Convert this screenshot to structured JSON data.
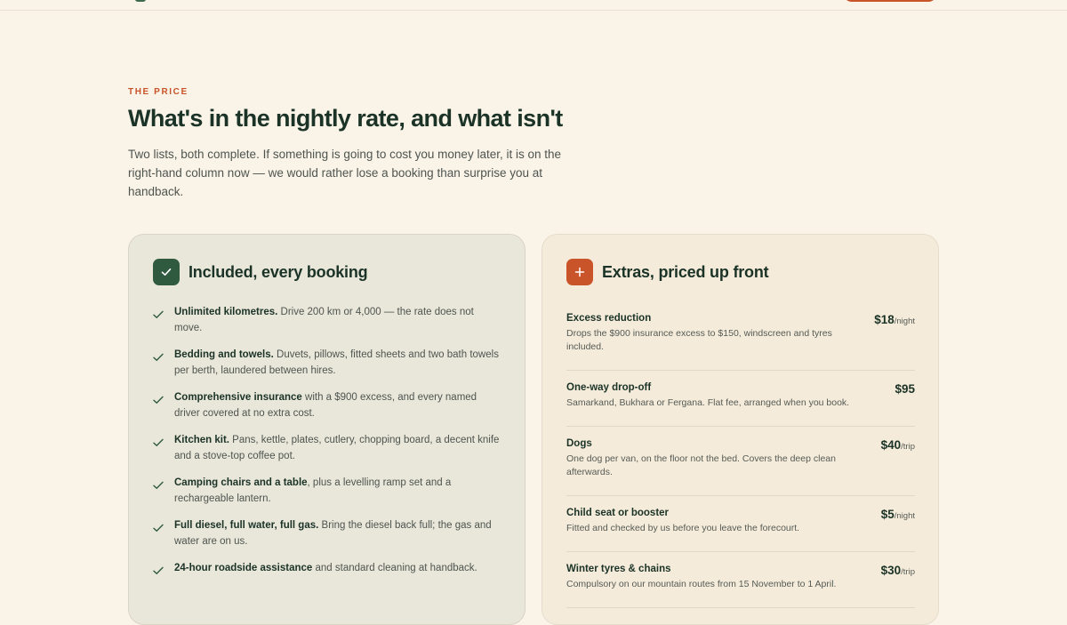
{
  "colors": {
    "background": "#faf3e8",
    "accent": "#c9542a",
    "green": "#2f5a40",
    "heading": "#1b3327"
  },
  "section": {
    "eyebrow": "THE PRICE",
    "headline": "What's in the nightly rate, and what isn't",
    "intro": "Two lists, both complete. If something is going to cost you money later, it is on the right-hand column now — we would rather lose a booking than surprise you at handback."
  },
  "included": {
    "icon": "check-icon",
    "title": "Included, every booking",
    "items": [
      {
        "bold": "Unlimited kilometres.",
        "text": " Drive 200 km or 4,000 — the rate does not move."
      },
      {
        "bold": "Bedding and towels.",
        "text": " Duvets, pillows, fitted sheets and two bath towels per berth, laundered between hires."
      },
      {
        "bold": "Comprehensive insurance",
        "text": " with a $900 excess, and every named driver covered at no extra cost."
      },
      {
        "bold": "Kitchen kit.",
        "text": " Pans, kettle, plates, cutlery, chopping board, a decent knife and a stove-top coffee pot."
      },
      {
        "bold": "Camping chairs and a table",
        "text": ", plus a levelling ramp set and a rechargeable lantern."
      },
      {
        "bold": "Full diesel, full water, full gas.",
        "text": " Bring the diesel back full; the gas and water are on us."
      },
      {
        "bold": "24-hour roadside assistance",
        "text": " and standard cleaning at handback."
      }
    ]
  },
  "extras": {
    "icon": "plus-icon",
    "title": "Extras, priced up front",
    "items": [
      {
        "name": "Excess reduction",
        "desc": "Drops the $900 insurance excess to $150, windscreen and tyres included.",
        "price": "$18",
        "unit": "/night"
      },
      {
        "name": "One-way drop-off",
        "desc": "Samarkand, Bukhara or Fergana. Flat fee, arranged when you book.",
        "price": "$95",
        "unit": ""
      },
      {
        "name": "Dogs",
        "desc": "One dog per van, on the floor not the bed. Covers the deep clean afterwards.",
        "price": "$40",
        "unit": "/trip"
      },
      {
        "name": "Child seat or booster",
        "desc": "Fitted and checked by us before you leave the forecourt.",
        "price": "$5",
        "unit": "/night"
      },
      {
        "name": "Winter tyres & chains",
        "desc": "Compulsory on our mountain routes from 15 November to 1 April.",
        "price": "$30",
        "unit": "/trip"
      }
    ]
  }
}
